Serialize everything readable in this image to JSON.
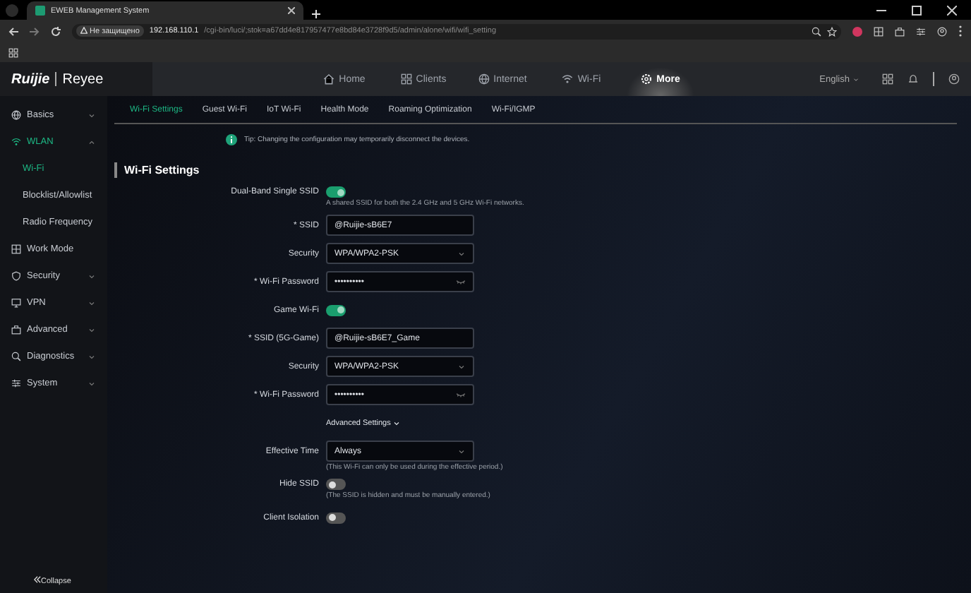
{
  "browser": {
    "tab_title": "EWEB Management System",
    "security_badge": "Не защищено",
    "url_host": "192.168.110.1",
    "url_path": "/cgi-bin/luci/;stok=a67dd4e817957477e8bd84e3728f9d5/admin/alone/wifi/wifi_setting"
  },
  "header": {
    "logo_brand": "Ruijie",
    "logo_product": "Reyee",
    "language": "English",
    "nav": [
      {
        "label": "Home",
        "selected": false
      },
      {
        "label": "Clients",
        "selected": false
      },
      {
        "label": "Internet",
        "selected": false
      },
      {
        "label": "Wi-Fi",
        "selected": false
      },
      {
        "label": "More",
        "selected": true
      }
    ]
  },
  "sidebar": {
    "items": [
      {
        "label": "Basics",
        "expanded": false,
        "selected": false
      },
      {
        "label": "WLAN",
        "expanded": true,
        "selected": true,
        "children": [
          {
            "label": "Wi-Fi",
            "selected": true
          },
          {
            "label": "Blocklist/Allowlist",
            "selected": false
          },
          {
            "label": "Radio Frequency",
            "selected": false
          }
        ]
      },
      {
        "label": "Work Mode",
        "selected": false
      },
      {
        "label": "Security",
        "expanded": false,
        "selected": false
      },
      {
        "label": "VPN",
        "expanded": false,
        "selected": false
      },
      {
        "label": "Advanced",
        "expanded": false,
        "selected": false
      },
      {
        "label": "Diagnostics",
        "expanded": false,
        "selected": false
      },
      {
        "label": "System",
        "expanded": false,
        "selected": false
      }
    ],
    "collapse": "Collapse"
  },
  "tabs": [
    {
      "label": "Wi-Fi Settings",
      "selected": true
    },
    {
      "label": "Guest Wi-Fi",
      "selected": false
    },
    {
      "label": "IoT Wi-Fi",
      "selected": false
    },
    {
      "label": "Health Mode",
      "selected": false
    },
    {
      "label": "Roaming Optimization",
      "selected": false
    },
    {
      "label": "Wi-Fi/IGMP",
      "selected": false
    }
  ],
  "tip": "Tip: Changing the configuration may temporarily disconnect the devices.",
  "section_title": "Wi-Fi Settings",
  "form": [
    {
      "kind": "toggle",
      "label": "Dual-Band Single SSID",
      "on": true,
      "hint": "A shared SSID for both the 2.4 GHz and 5 GHz Wi-Fi networks."
    },
    {
      "kind": "text",
      "label": "* SSID",
      "value": "@Ruijie-sB6E7"
    },
    {
      "kind": "select",
      "label": "Security",
      "value": "WPA/WPA2-PSK"
    },
    {
      "kind": "password",
      "label": "* Wi-Fi Password",
      "value": "••••••••••"
    },
    {
      "kind": "toggle",
      "label": "Game Wi-Fi",
      "on": true
    },
    {
      "kind": "text",
      "label": "* SSID (5G-Game)",
      "value": "@Ruijie-sB6E7_Game"
    },
    {
      "kind": "select",
      "label": "Security",
      "value": "WPA/WPA2-PSK"
    },
    {
      "kind": "password",
      "label": "* Wi-Fi Password",
      "value": "••••••••••"
    },
    {
      "kind": "link",
      "label": "Advanced Settings"
    },
    {
      "kind": "select",
      "label": "Effective Time",
      "value": "Always",
      "hint": "(This Wi-Fi can only be used during the effective period.)"
    },
    {
      "kind": "toggle",
      "label": "Hide SSID",
      "on": false,
      "hint": "(The SSID is hidden and must be manually entered.)"
    },
    {
      "kind": "toggle",
      "label": "Client Isolation",
      "on": false
    }
  ]
}
